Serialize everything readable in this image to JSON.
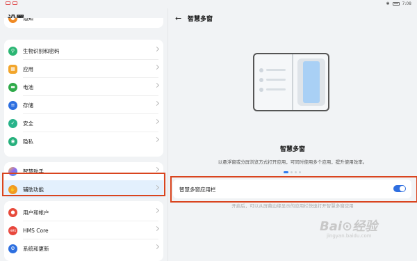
{
  "status": {
    "time": "7:08"
  },
  "settings": {
    "title": "设置",
    "group0": [
      {
        "label": "通知",
        "icon": "bell-icon"
      }
    ],
    "group1": [
      {
        "label": "生物识别和密码",
        "icon": "key-icon"
      },
      {
        "label": "应用",
        "icon": "apps-icon"
      },
      {
        "label": "电池",
        "icon": "battery-icon"
      },
      {
        "label": "存储",
        "icon": "storage-icon"
      },
      {
        "label": "安全",
        "icon": "shield-icon"
      },
      {
        "label": "隐私",
        "icon": "privacy-icon"
      }
    ],
    "group2": [
      {
        "label": "智慧助手",
        "icon": "assistant-icon"
      },
      {
        "label": "辅助功能",
        "icon": "hand-icon"
      }
    ],
    "group3": [
      {
        "label": "用户和帐户",
        "icon": "user-icon"
      },
      {
        "label": "HMS Core",
        "icon": "hms-icon"
      },
      {
        "label": "系统和更新",
        "icon": "gear-icon"
      }
    ]
  },
  "detail": {
    "title": "智慧多窗",
    "feature_title": "智慧多窗",
    "feature_desc": "以悬浮窗或分屏浏览方式打开应用，可同时使用多个应用，提升使用效率。",
    "toggle_label": "智慧多窗应用栏",
    "toggle_on": true,
    "below_text": "开启后，可以从屏幕边缘显示的应用栏快速打开智慧多窗应用"
  },
  "colors": {
    "accent": "#2f6fe0",
    "highlight": "#d9441e",
    "selected_bg": "#e3f0fd"
  }
}
